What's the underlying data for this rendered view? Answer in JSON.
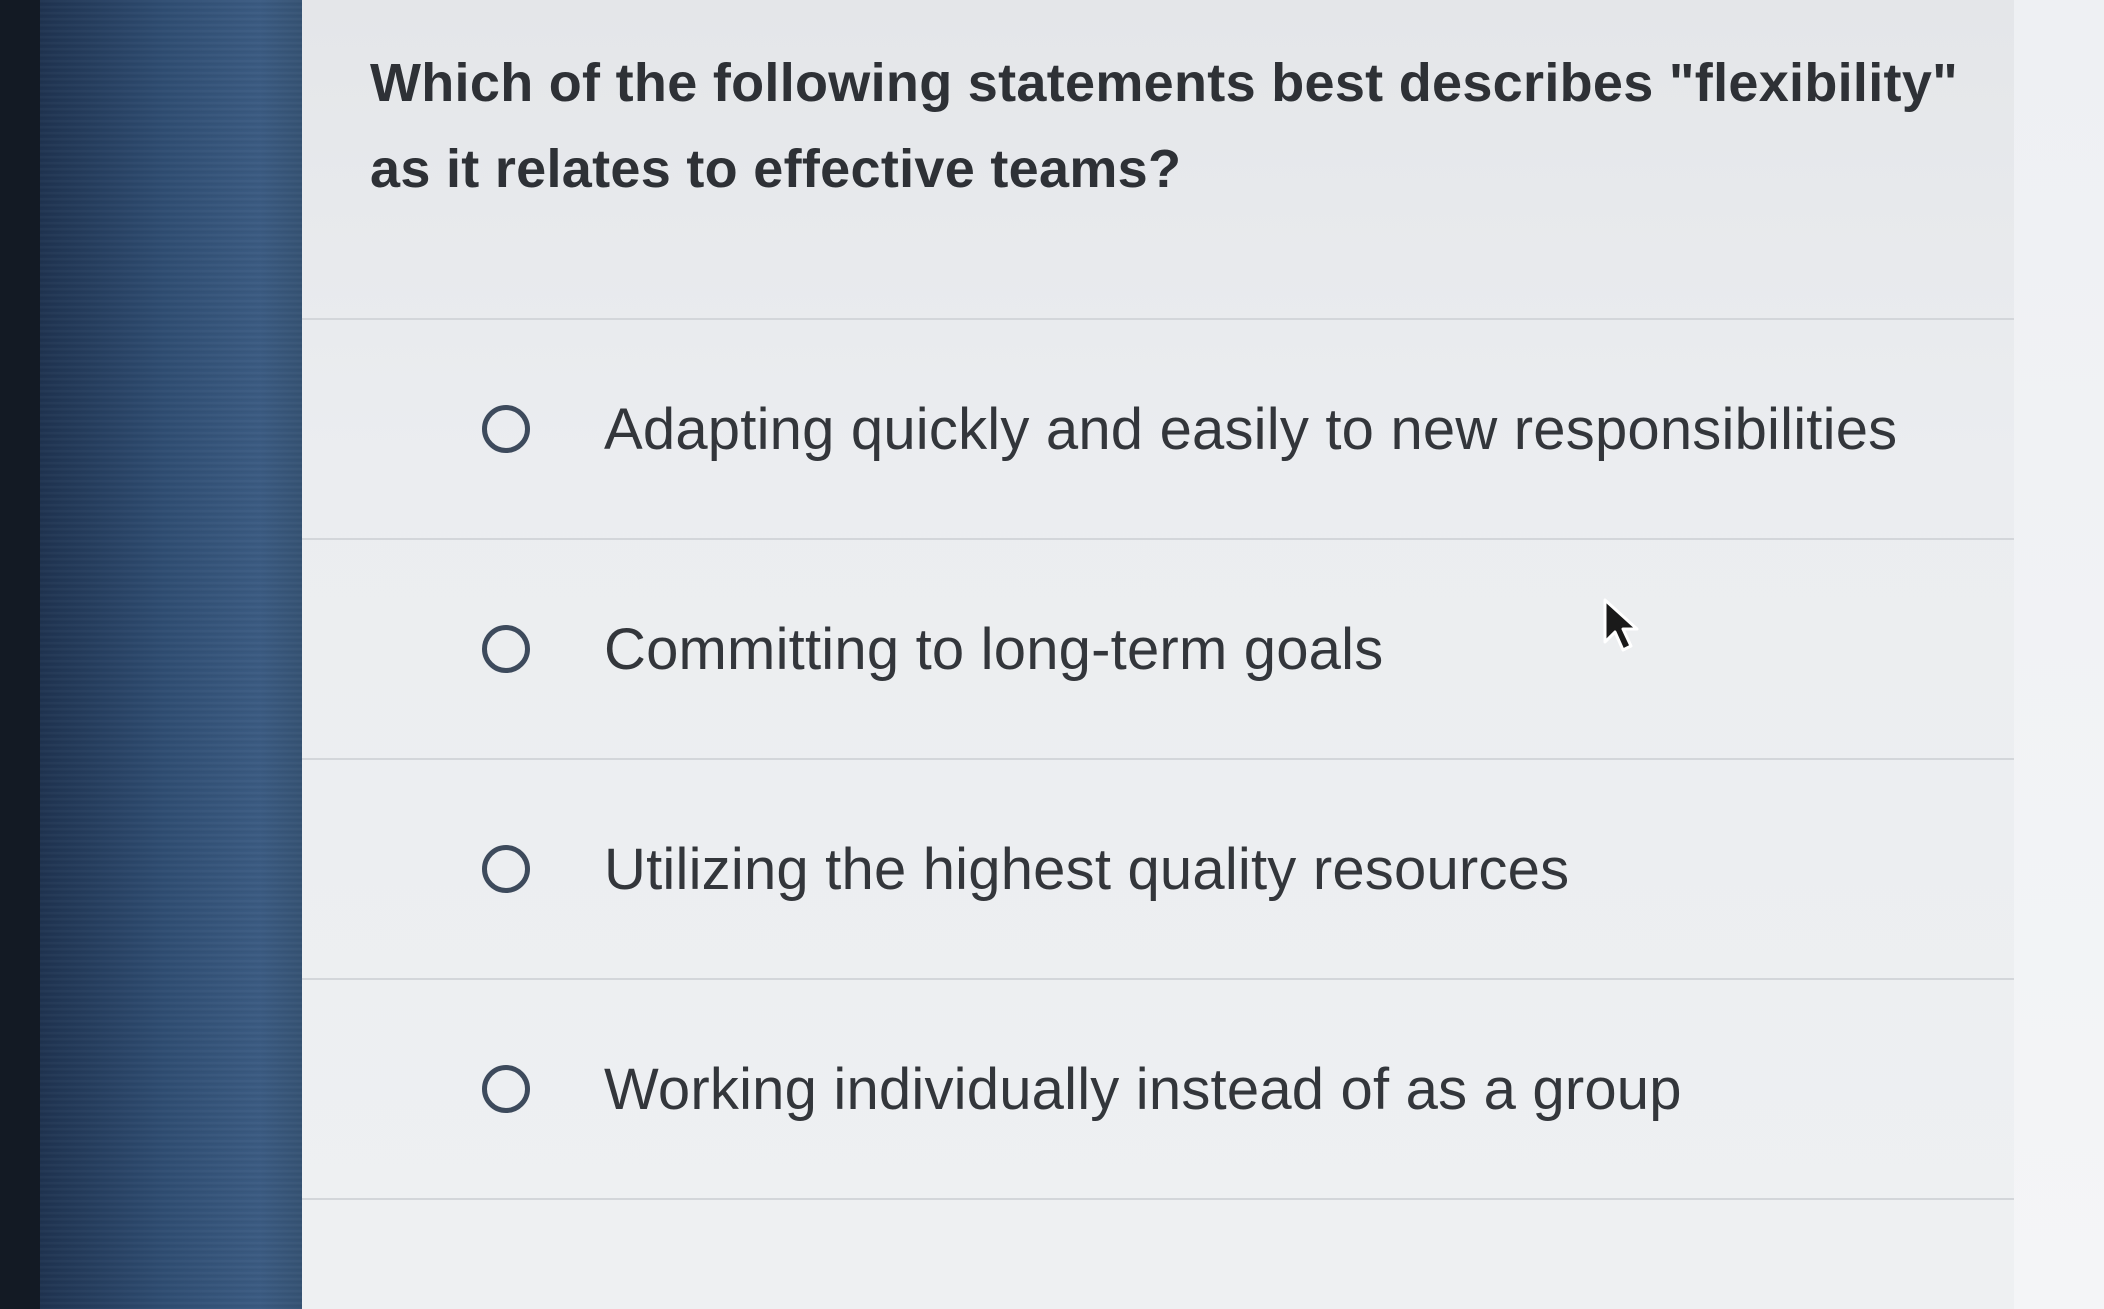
{
  "question": {
    "text": "Which of the following statements best describes \"flexibility\" as it relates to effective teams?"
  },
  "options": [
    {
      "label": "Adapting quickly and easily to new responsibilities",
      "selected": false
    },
    {
      "label": "Committing to long-term goals",
      "selected": false
    },
    {
      "label": "Utilizing the highest quality resources",
      "selected": false
    },
    {
      "label": "Working individually instead of as a group",
      "selected": false
    }
  ],
  "colors": {
    "sidebar": "#2f4d72",
    "panel": "#eceef1",
    "text": "#2e3136",
    "radio_border": "#3d4a5c"
  },
  "icons": {
    "radio": "radio-unchecked-icon",
    "pointer": "mouse-pointer-icon"
  }
}
